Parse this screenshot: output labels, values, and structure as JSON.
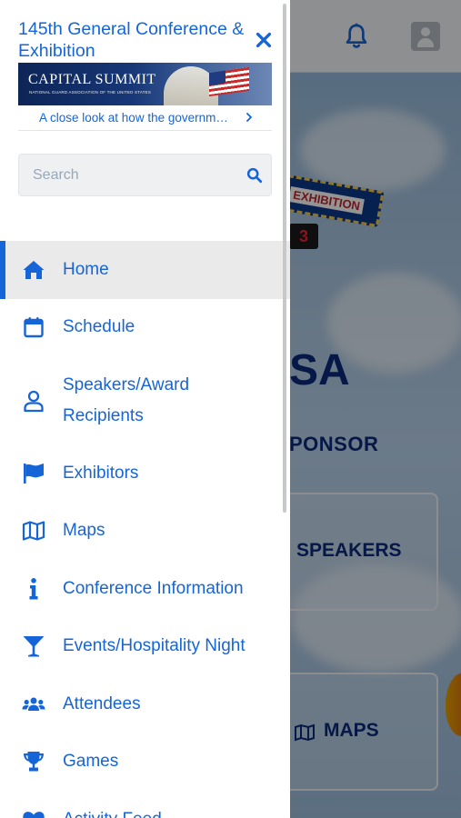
{
  "drawer": {
    "conference_title": "145th General Conference & Exhibition",
    "banner": {
      "title": "CAPITAL SUMMIT",
      "subtitle": "NATIONAL GUARD ASSOCIATION OF THE UNITED STATES"
    },
    "tagline": "A close look at how the governm…",
    "search": {
      "placeholder": "Search"
    },
    "nav": [
      {
        "label": "Home",
        "icon": "home-icon",
        "active": true
      },
      {
        "label": "Schedule",
        "icon": "calendar-icon"
      },
      {
        "label": "Speakers/Award Recipients",
        "icon": "person-icon"
      },
      {
        "label": "Exhibitors",
        "icon": "flag-icon"
      },
      {
        "label": "Maps",
        "icon": "map-icon"
      },
      {
        "label": "Conference Information",
        "icon": "info-icon"
      },
      {
        "label": "Events/Hospitality Night",
        "icon": "cocktail-icon"
      },
      {
        "label": "Attendees",
        "icon": "users-icon"
      },
      {
        "label": "Games",
        "icon": "trophy-icon"
      },
      {
        "label": "Activity Feed",
        "icon": "heart-icon"
      }
    ]
  },
  "background": {
    "badge_text": "EXHIBITION",
    "badge_number": "3",
    "big_text": "SA",
    "sponsor_text": "PONSOR",
    "card_speakers": "SPEAKERS",
    "card_maps": "MAPS"
  },
  "colors": {
    "accent": "#1565d8",
    "active_bg": "#eaeaea",
    "overlay": "rgba(0,0,0,0.42)"
  }
}
